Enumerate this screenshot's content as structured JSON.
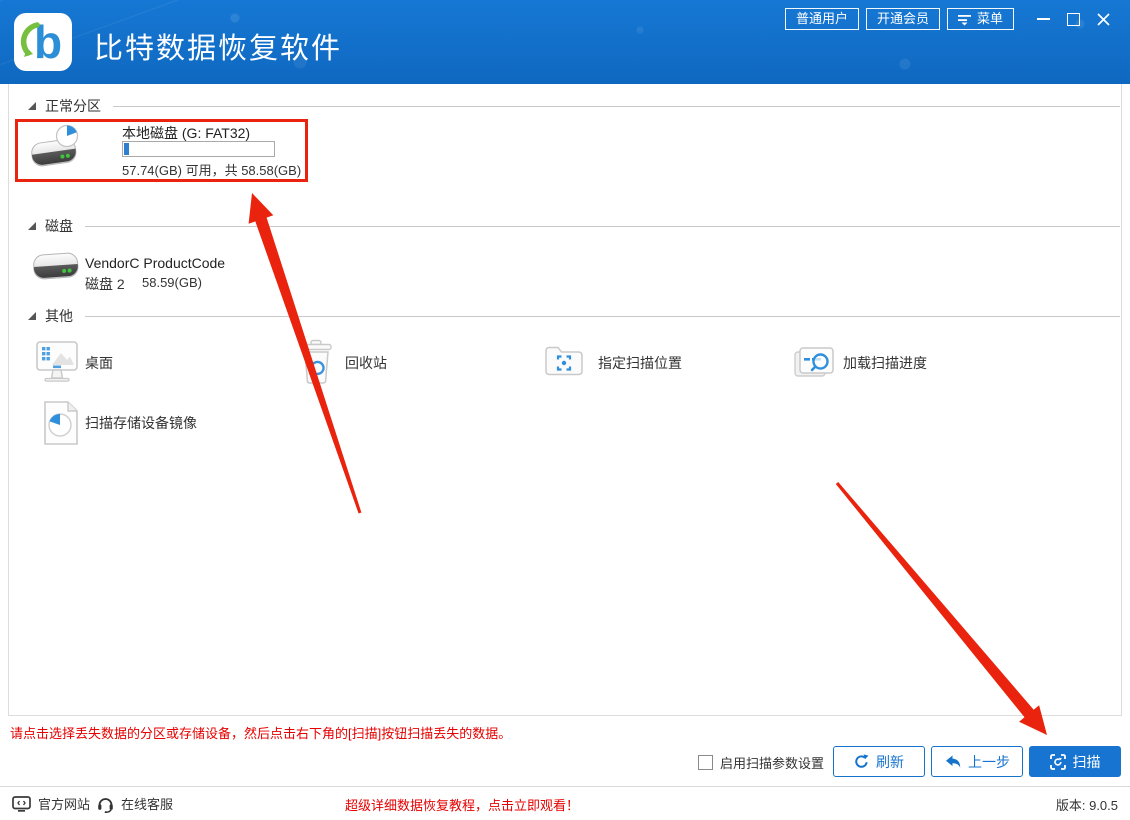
{
  "header": {
    "title": "比特数据恢复软件",
    "user_button": "普通用户",
    "vip_button": "开通会员",
    "menu_button": "菜单"
  },
  "sections": {
    "partition": {
      "title": "正常分区",
      "item": {
        "name": "本地磁盘 (G: FAT32)",
        "size_info": "57.74(GB) 可用，共 58.58(GB)"
      }
    },
    "disk": {
      "title": "磁盘",
      "item": {
        "name": "VendorC ProductCode",
        "label": "磁盘 2",
        "size": "58.59(GB)"
      }
    },
    "other": {
      "title": "其他",
      "items": [
        {
          "label": "桌面"
        },
        {
          "label": "回收站"
        },
        {
          "label": "指定扫描位置"
        },
        {
          "label": "加载扫描进度"
        },
        {
          "label": "扫描存储设备镜像"
        }
      ]
    }
  },
  "hint": "请点击选择丢失数据的分区或存储设备，然后点击右下角的[扫描]按钮扫描丢失的数据。",
  "controls": {
    "scan_params": "启用扫描参数设置",
    "refresh": "刷新",
    "previous": "上一步",
    "scan": "扫描"
  },
  "footer": {
    "official_site": "官方网站",
    "online_support": "在线客服",
    "tutorial": "超级详细数据恢复教程，点击立即观看！",
    "version": "版本: 9.0.5"
  },
  "colors": {
    "brand_blue": "#1373cd",
    "action_blue": "#1673cc",
    "annotation_red": "#e9230d",
    "hint_red": "#e60000"
  }
}
